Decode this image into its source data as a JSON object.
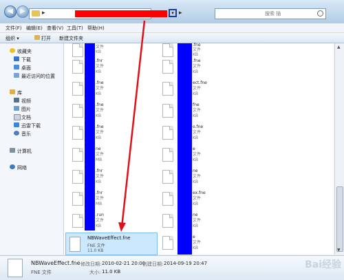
{
  "search": {
    "placeholder": "搜索 插"
  },
  "menu": [
    "文件(F)",
    "编辑(E)",
    "查看(V)",
    "工具(T)",
    "帮助(H)"
  ],
  "toolbar": {
    "organize": "组织 ▾",
    "open": "打开",
    "new_folder": "新建文件夹"
  },
  "nav": {
    "favorites": "收藏夹",
    "downloads": "下载",
    "desktop": "桌面",
    "recent": "最近访问的位置",
    "libraries": "库",
    "videos": "视频",
    "pictures": "图片",
    "documents": "文档",
    "thunder": "迅雷下载",
    "music": "音乐",
    "computer": "计算机",
    "network": "网络"
  },
  "left_files": [
    {
      "name": "",
      "type": "文件",
      "size": "KB"
    },
    {
      "name": ".fnr",
      "type": "文件",
      "size": "KB"
    },
    {
      "name": ".fne",
      "type": "文件",
      "size": "KB"
    },
    {
      "name": ".fne",
      "type": "文件",
      "size": "KB"
    },
    {
      "name": ".fne",
      "type": "文件",
      "size": "KB"
    },
    {
      "name": "ne",
      "type": "文件",
      "size": "MB"
    },
    {
      "name": ".fnr",
      "type": "文件",
      "size": "KB"
    },
    {
      "name": ".fnr",
      "type": "文件",
      "size": "MB"
    },
    {
      "name": ".run",
      "type": "文件",
      "size": "KB"
    }
  ],
  "right_files": [
    {
      "name": ".fne",
      "type": "文件",
      "size": "KB"
    },
    {
      "name": ".fne",
      "type": "文件",
      "size": "KB"
    },
    {
      "name": "ect.fne",
      "type": "文件",
      "size": "KB"
    },
    {
      "name": "fne",
      "type": "文件",
      "size": "KB"
    },
    {
      "name": "o.fne",
      "type": "文件",
      "size": "KB"
    },
    {
      "name": "e",
      "type": "文件",
      "size": "KB"
    },
    {
      "name": "ne",
      "type": "文件",
      "size": "KB"
    },
    {
      "name": "ex.fne",
      "type": "文件",
      "size": "KB"
    },
    {
      "name": "ne",
      "type": "文件",
      "size": "KB"
    },
    {
      "name": "e",
      "type": "文件",
      "size": "KB"
    }
  ],
  "selected": {
    "name": "NBWaveEffect.fne",
    "type": "FNE 文件",
    "size": "11.0 KB"
  },
  "details": {
    "name": "NBWaveEffect.fne",
    "modified_label": "修改日期:",
    "modified": "2010-02-21 20:00",
    "created_label": "创建日期:",
    "created": "2014-09-19 20:47",
    "type": "FNE 文件",
    "size_label": "大小:",
    "size": "11.0 KB"
  },
  "watermark": "Bai经验",
  "colors": {
    "redaction": "#ff0000",
    "blue_mask": "#0000ff",
    "arrow": "#e0101a",
    "selection": "#cce8ff"
  }
}
